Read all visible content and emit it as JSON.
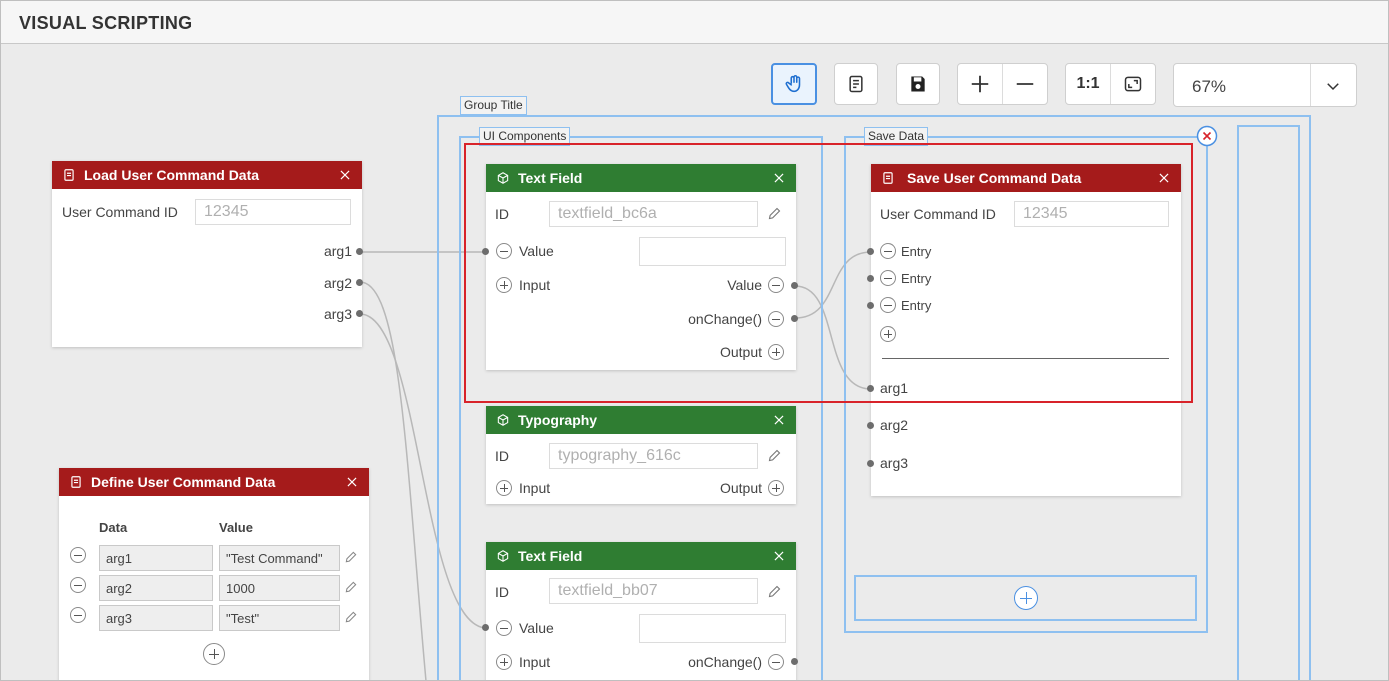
{
  "header": {
    "title": "VISUAL SCRIPTING"
  },
  "toolbar": {
    "zoom": "67%",
    "one_to_one": "1:1"
  },
  "groups": {
    "outer_label": "Group Title",
    "ui_label": "UI Components",
    "save_label": "Save Data"
  },
  "load_node": {
    "title": "Load User Command Data",
    "id_label": "User Command ID",
    "id_placeholder": "12345",
    "outputs": [
      "arg1",
      "arg2",
      "arg3"
    ]
  },
  "define_node": {
    "title": "Define User Command Data",
    "col_data": "Data",
    "col_value": "Value",
    "rows": [
      {
        "data": "arg1",
        "value": "\"Test Command\""
      },
      {
        "data": "arg2",
        "value": "1000"
      },
      {
        "data": "arg3",
        "value": "\"Test\""
      }
    ]
  },
  "text_field_1": {
    "title": "Text Field",
    "id_label": "ID",
    "id_value": "textfield_bc6a",
    "value_label": "Value",
    "input_label": "Input",
    "out_value_label": "Value",
    "onchange_label": "onChange()",
    "output_label": "Output"
  },
  "typography": {
    "title": "Typography",
    "id_label": "ID",
    "id_value": "typography_616c",
    "input_label": "Input",
    "output_label": "Output"
  },
  "text_field_2": {
    "title": "Text Field",
    "id_label": "ID",
    "id_value": "textfield_bb07",
    "value_label": "Value",
    "input_label": "Input",
    "onchange_label": "onChange()"
  },
  "save_node": {
    "title": "Save User Command Data",
    "id_label": "User Command ID",
    "id_placeholder": "12345",
    "entries": [
      "Entry",
      "Entry",
      "Entry"
    ],
    "args": [
      "arg1",
      "arg2",
      "arg3"
    ]
  },
  "colors": {
    "node_red": "#a51b1b",
    "node_green": "#2f7d32",
    "group_border": "#8ec0f0",
    "accent": "#4a90e2",
    "highlight": "#d8232a"
  }
}
